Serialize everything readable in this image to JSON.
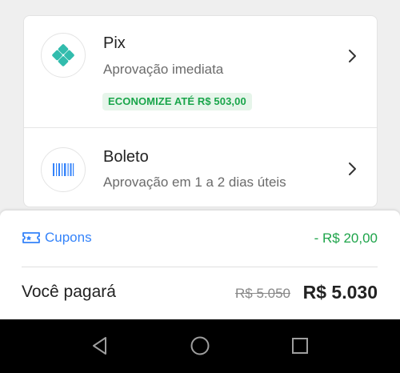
{
  "payment_options": [
    {
      "title": "Pix",
      "subtitle": "Aprovação imediata",
      "badge": "ECONOMIZE ATÉ R$ 503,00",
      "icon": "pix-icon"
    },
    {
      "title": "Boleto",
      "subtitle": "Aprovação em 1 a 2 dias úteis",
      "icon": "barcode-icon"
    }
  ],
  "summary": {
    "coupon_label": "Cupons",
    "coupon_icon": "ticket-icon",
    "discount": "- R$ 20,00",
    "pay_label": "Você pagará",
    "old_price": "R$ 5.050",
    "new_price": "R$ 5.030"
  },
  "navigation": {
    "back_icon": "back-triangle-icon",
    "home_icon": "home-circle-icon",
    "recents_icon": "recents-square-icon"
  },
  "colors": {
    "accent_blue": "#3483fa",
    "pix_teal": "#32bcad",
    "success_green": "#19a54a",
    "badge_bg": "#e6f5ea"
  }
}
